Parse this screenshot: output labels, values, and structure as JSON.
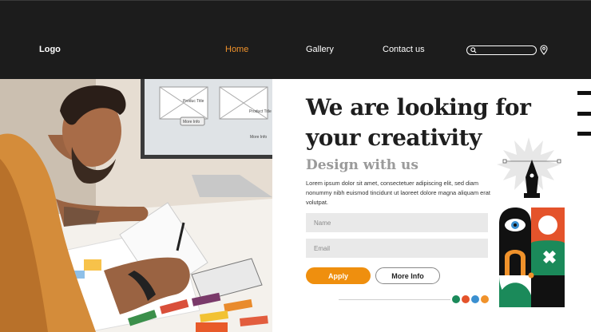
{
  "header": {
    "logo": "Logo",
    "nav": [
      {
        "label": "Home",
        "active": true
      },
      {
        "label": "Gallery",
        "active": false
      },
      {
        "label": "Contact us",
        "active": false
      }
    ],
    "search": {
      "placeholder": ""
    }
  },
  "hero": {
    "headline_line1": "We are looking for",
    "headline_line2": "your creativity",
    "subhead": "Design with us",
    "body": "Lorem ipsum dolor sit amet, consectetuer adipiscing elit, sed diam nonummy nibh euismod tincidunt ut laoreet dolore magna aliquam erat volutpat.",
    "form": {
      "name_placeholder": "Name",
      "email_placeholder": "Email"
    },
    "buttons": {
      "apply": "Apply",
      "more_info": "More Info"
    }
  },
  "photo": {
    "screen_label_1": "Produc Title",
    "screen_label_2": "Product Title",
    "screen_label_3": "More Info",
    "screen_label_4": "More Info"
  },
  "colors": {
    "header_bg": "#1c1c1c",
    "accent": "#f0922b",
    "apply_button": "#ef8f0e",
    "dots": [
      "#1b8a5a",
      "#e4532b",
      "#3a8fd0",
      "#f0922b"
    ]
  }
}
